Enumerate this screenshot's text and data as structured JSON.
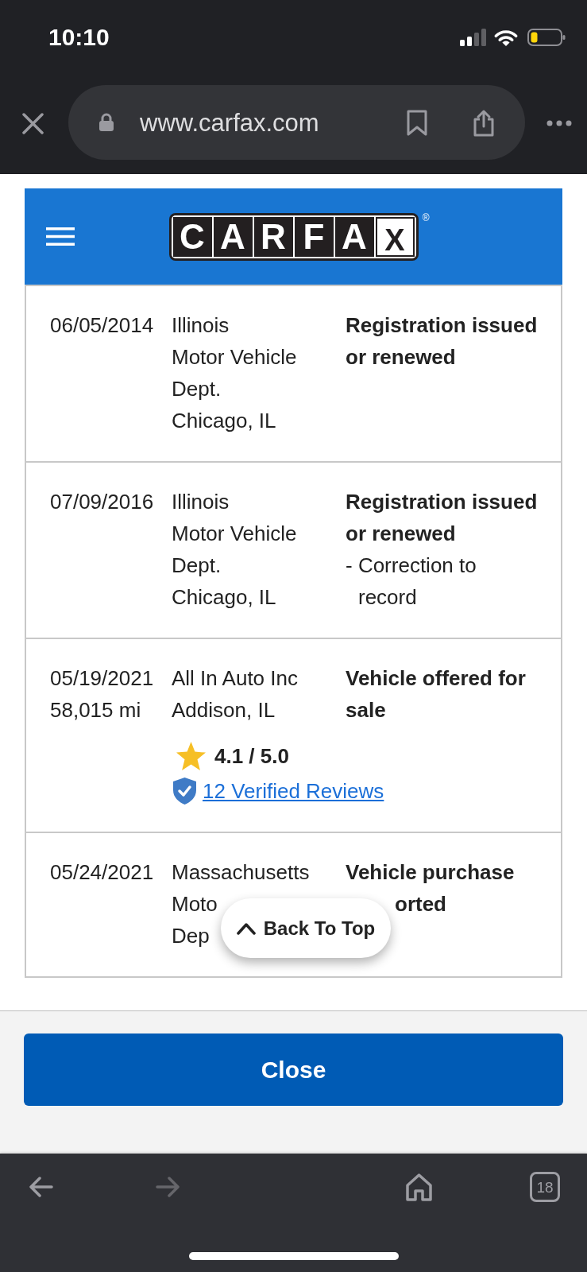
{
  "status_bar": {
    "time": "10:10"
  },
  "browser": {
    "url": "www.carfax.com"
  },
  "header": {
    "logo_letters": [
      "C",
      "A",
      "R",
      "F",
      "A",
      "X"
    ],
    "logo_mark": "®"
  },
  "history": [
    {
      "date": "06/05/2014",
      "source": [
        "Illinois",
        "Motor Vehicle Dept.",
        "Chicago, IL"
      ],
      "event": "Registration issued or renewed"
    },
    {
      "date": "07/09/2016",
      "source": [
        "Illinois",
        "Motor Vehicle Dept.",
        "Chicago, IL"
      ],
      "event": "Registration issued or renewed",
      "note": "- Correction to record"
    },
    {
      "date": "05/19/2021",
      "mileage": "58,015 mi",
      "source": [
        "All In Auto Inc",
        "Addison, IL"
      ],
      "rating": "4.1 / 5.0",
      "reviews_link": "12 Verified Reviews",
      "event": "Vehicle offered for sale"
    },
    {
      "date": "05/24/2021",
      "source": [
        "Massachusetts",
        "Moto",
        "Dep"
      ],
      "event": "Vehicle purchase",
      "event_tail": "orted"
    }
  ],
  "back_to_top": {
    "label": "Back To Top"
  },
  "close_button": {
    "label": "Close"
  },
  "toolbar": {
    "back": {
      "disabled": false
    },
    "forward": {
      "disabled": true
    },
    "tab_count": "18"
  }
}
